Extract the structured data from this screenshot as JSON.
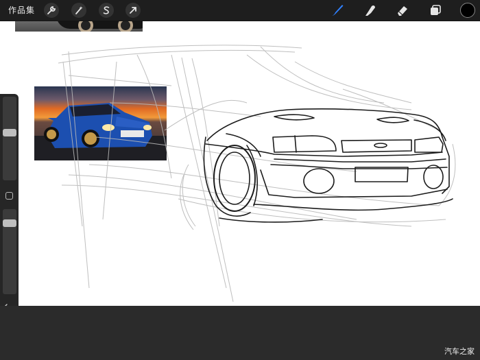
{
  "topbar": {
    "gallery_label": "作品集",
    "tools_left": [
      {
        "name": "actions",
        "icon": "wrench-icon"
      },
      {
        "name": "adjustments",
        "icon": "magic-wand-icon"
      },
      {
        "name": "selection",
        "icon": "selection-s-icon"
      },
      {
        "name": "transform",
        "icon": "arrow-cursor-icon"
      }
    ],
    "tools_right": [
      {
        "name": "brush",
        "icon": "brush-icon",
        "active": true,
        "color": "#2f80ff"
      },
      {
        "name": "smudge",
        "icon": "smudge-icon"
      },
      {
        "name": "eraser",
        "icon": "eraser-icon"
      },
      {
        "name": "layers",
        "icon": "layers-icon"
      }
    ],
    "current_color": "#000000"
  },
  "sidebar": {
    "brush_size_level": 0.58,
    "opacity_level": 0.87,
    "undo_icon": "undo-icon",
    "redo_icon": "redo-icon"
  },
  "watermark": "汽车之家"
}
